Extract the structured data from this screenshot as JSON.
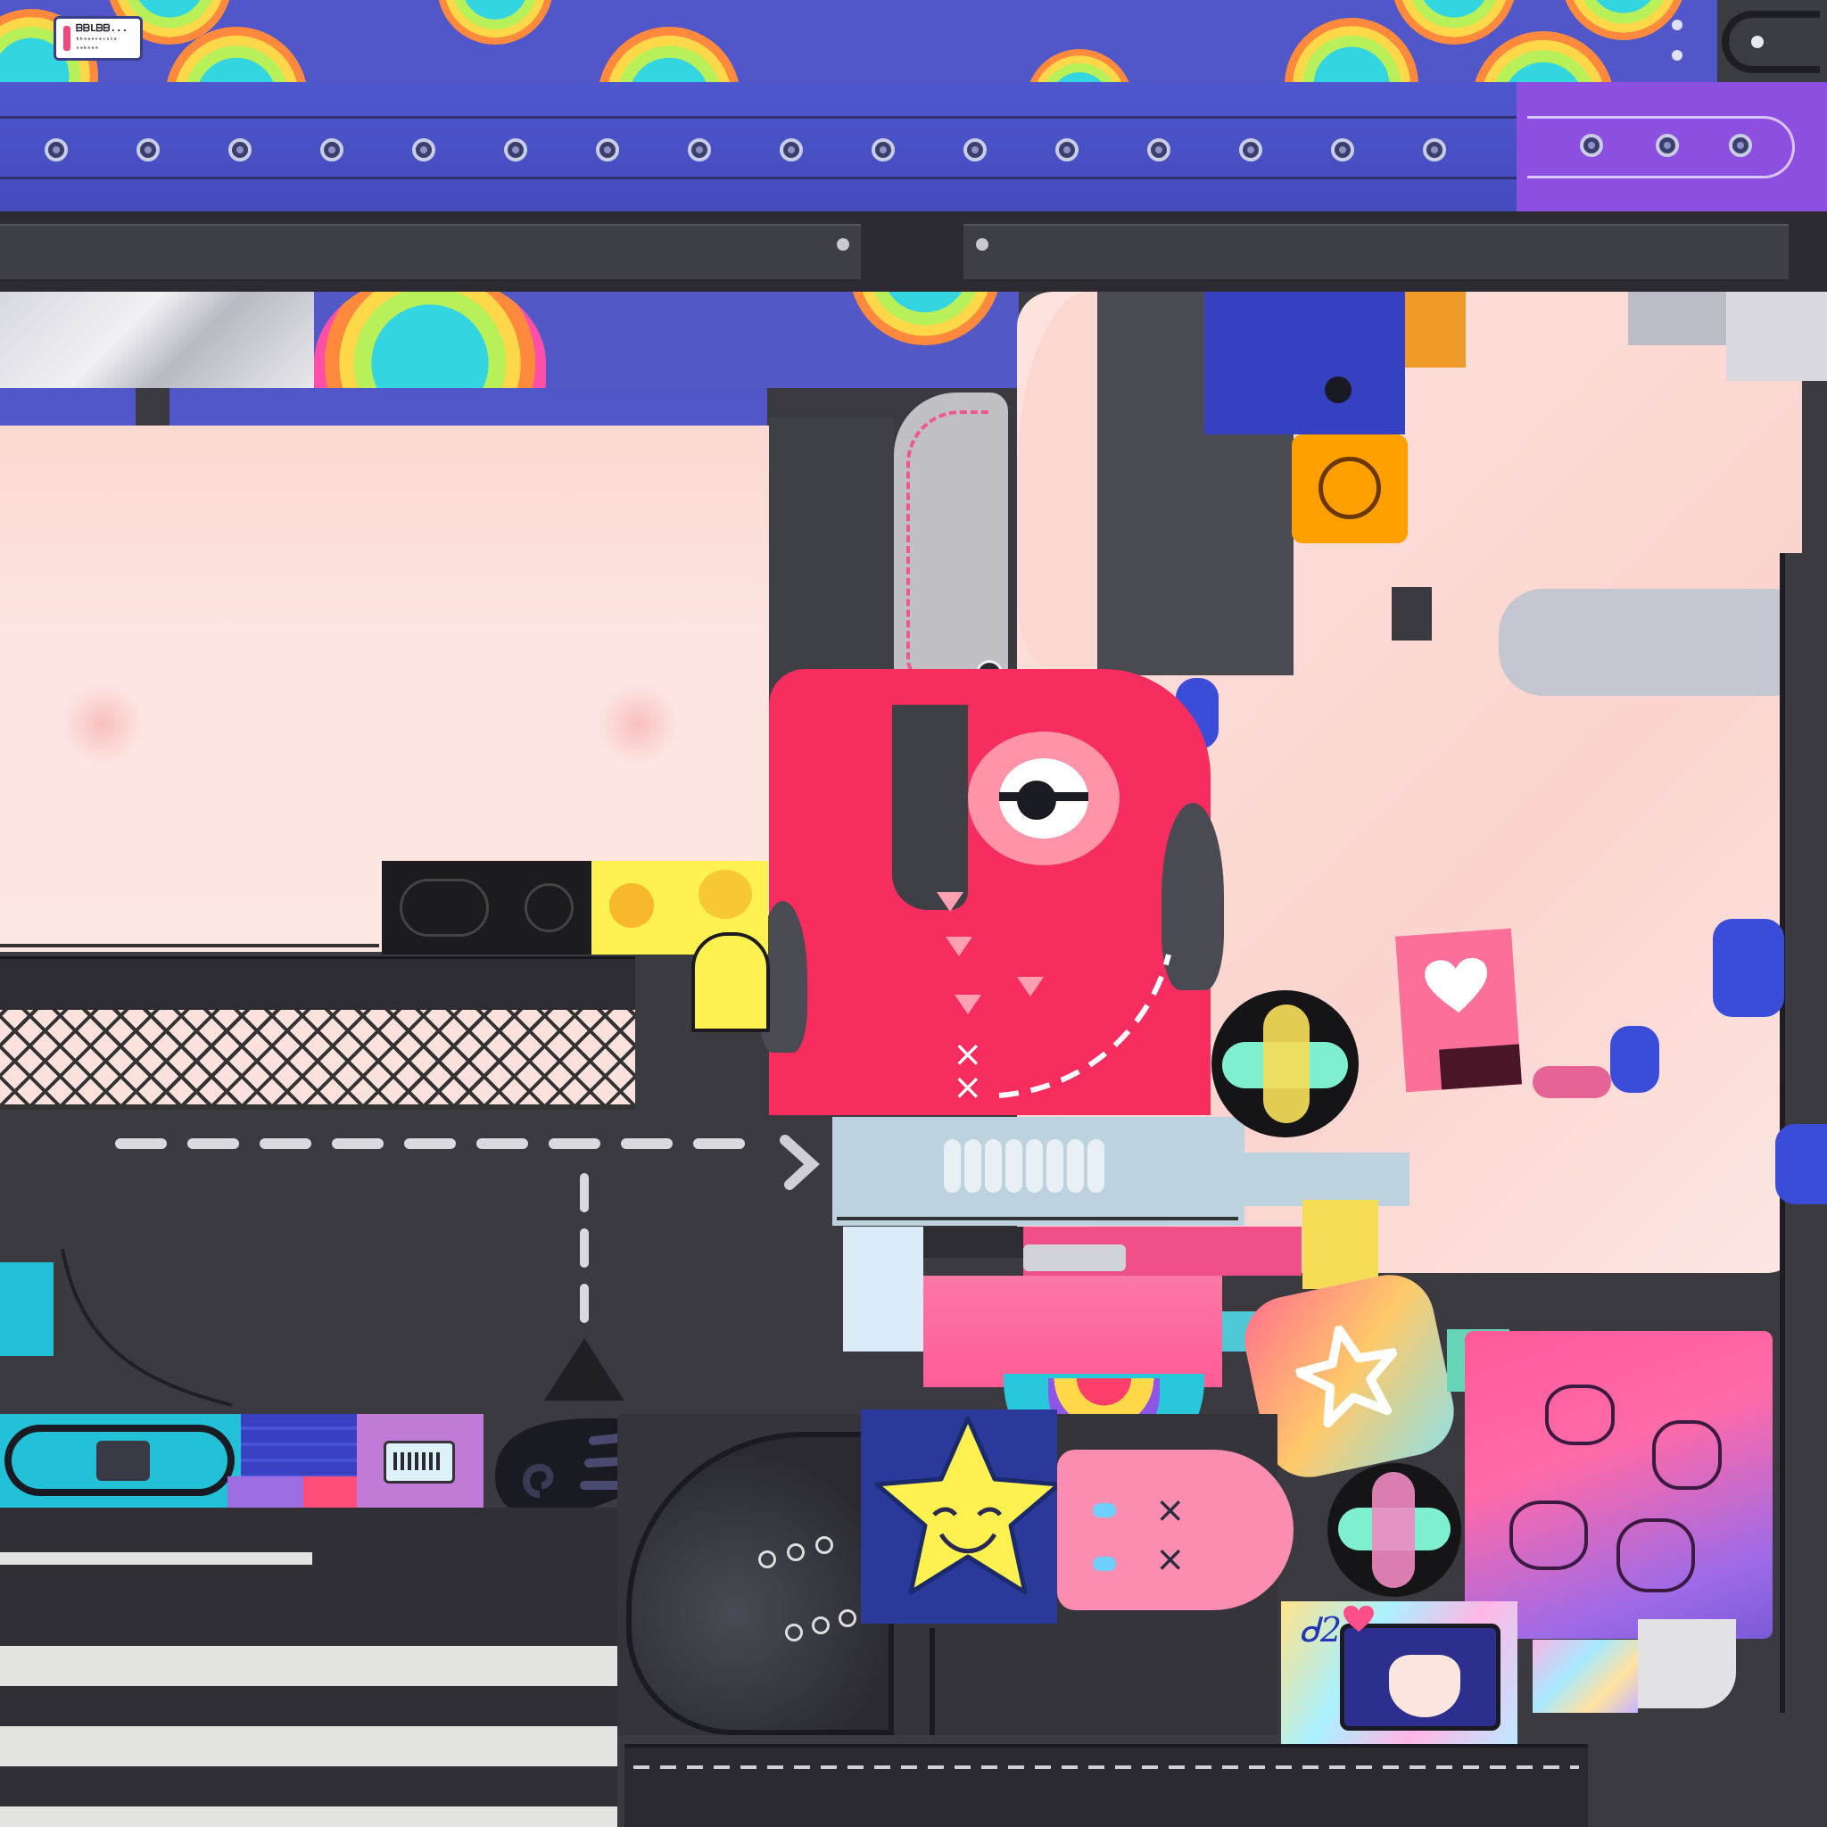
{
  "palette": {
    "belt_blue": "#5157c8",
    "belt_purple": "#9a55e6",
    "charcoal": "#3a3a40",
    "skin": "#fde1dc",
    "hot_pink": "#f72d5f",
    "mint": "#7ff0cf",
    "yellow": "#fff150",
    "cyan": "#2ad3e6"
  },
  "belt_tag": {
    "line1": "ᗷᗷLᗷᗷ...",
    "line2": "ᵇᵇᵃᵃᵐⁿᵃᶜᵘⁱᵉ",
    "line3": "ᵘᵃᵇᵒᵃᵐ"
  },
  "icons": {
    "heart": "heart-icon",
    "star": "star-icon",
    "star_outline": "star-outline-icon",
    "bandage": "bandage-icon",
    "wing": "wing-icon",
    "eye": "eye-icon",
    "battery": "battery-icon"
  },
  "sticker": {
    "signature": "ᑯ2~"
  }
}
